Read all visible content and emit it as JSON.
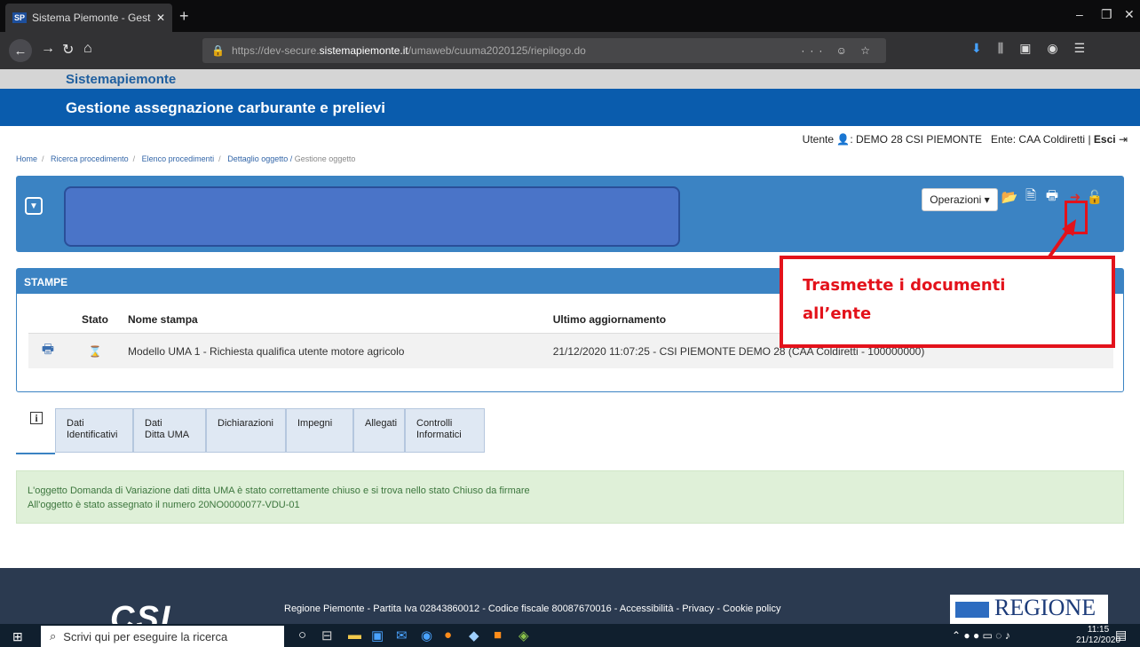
{
  "browser": {
    "tab_title": "Sistema Piemonte - Gestione a",
    "tab_favicon": "SP",
    "url_prefix": "https://dev-secure.",
    "url_domain": "sistemapiemonte.it",
    "url_path": "/umaweb/cuuma2020125/riepilogo.do",
    "url_actions": "··· ☺ ☆"
  },
  "site": {
    "brand": "Sistemapiemonte",
    "app_title": "Gestione assegnazione carburante e prelievi"
  },
  "user": {
    "prefix": "Utente",
    "name": "DEMO 28 CSI PIEMONTE",
    "ente": "Ente: CAA Coldiretti",
    "logout": "Esci"
  },
  "breadcrumb": [
    "Home",
    "Ricerca procedimento",
    "Elenco procedimenti",
    "Dettaglio oggetto"
  ],
  "breadcrumb_current": "Gestione oggetto",
  "toolbar": {
    "operations_label": "Operazioni ▾"
  },
  "stampe": {
    "title": "STAMPE",
    "columns": [
      "Stato",
      "Nome stampa",
      "Ultimo aggiornamento"
    ],
    "rows": [
      {
        "name": "Modello UMA 1 - Richiesta qualifica utente motore agricolo",
        "updated": "21/12/2020 11:07:25 - CSI PIEMONTE DEMO 28 (CAA Coldiretti - 100000000)"
      }
    ]
  },
  "callout": {
    "line1": "Trasmette i documenti",
    "line2": "all’ente"
  },
  "tabs": [
    {
      "l1": "Dati",
      "l2": "Identificativi"
    },
    {
      "l1": "Dati",
      "l2": "Ditta UMA"
    },
    {
      "l1": "Dichiarazioni",
      "l2": ""
    },
    {
      "l1": "Impegni",
      "l2": ""
    },
    {
      "l1": "Allegati",
      "l2": ""
    },
    {
      "l1": "Controlli",
      "l2": "Informatici"
    }
  ],
  "alert": {
    "line1": "L'oggetto Domanda di Variazione dati ditta UMA è stato correttamente chiuso e si trova nello stato Chiuso da firmare",
    "line2": "All'oggetto è stato assegnato il numero 20NO0000077-VDU-01"
  },
  "footer": {
    "logo": "CSI",
    "links": "Regione Piemonte - Partita Iva 02843860012 - Codice fiscale 80087670016 - Accessibilità - Privacy - Cookie policy",
    "regione": "REGIONE"
  },
  "taskbar": {
    "search_placeholder": "Scrivi qui per eseguire la ricerca",
    "time": "11:15",
    "date": "21/12/2020"
  },
  "colors": {
    "brand_blue": "#0a5cad",
    "panel_blue": "#3b83c3",
    "highlight_red": "#e3121b"
  }
}
